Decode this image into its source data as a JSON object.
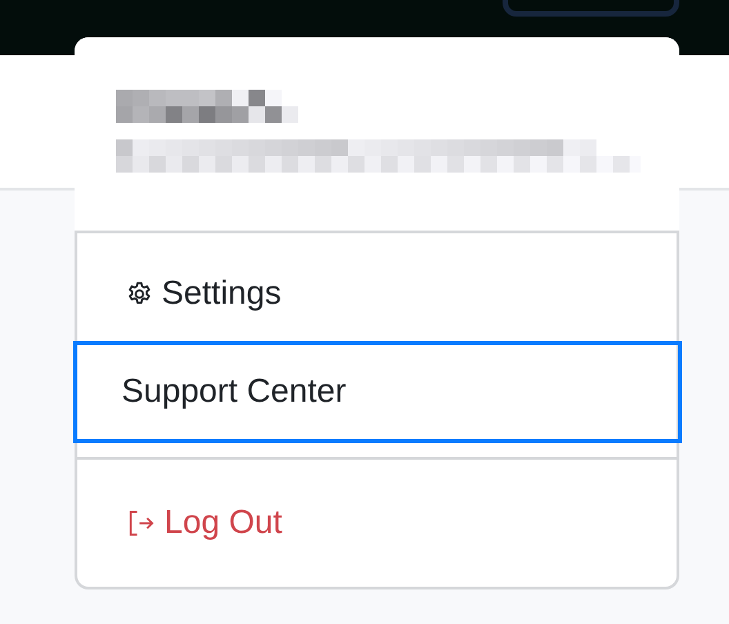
{
  "menu": {
    "items": [
      {
        "kind": "settings",
        "label": "Settings",
        "selected": false
      },
      {
        "kind": "link",
        "label": "Support Center",
        "selected": true
      },
      {
        "kind": "logout",
        "label": "Log Out",
        "selected": false
      }
    ]
  }
}
